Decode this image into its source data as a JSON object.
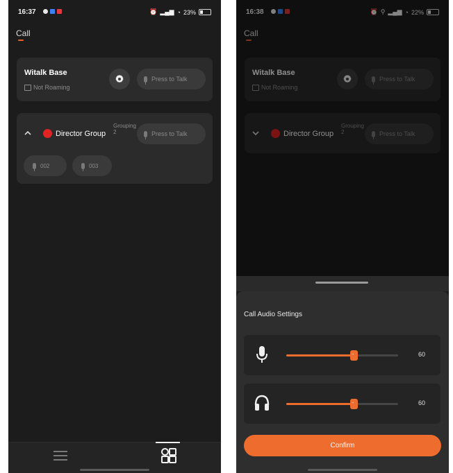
{
  "left": {
    "status": {
      "time": "16:37",
      "battery": "23%"
    },
    "app_title": "Call",
    "base": {
      "name": "Witalk Base",
      "roaming": "Not Roaming",
      "ptt_label": "Press to Talk"
    },
    "group": {
      "name": "Director Group",
      "grouping_label": "Grouping 2",
      "ptt_label": "Press to Talk",
      "members": [
        "002",
        "003"
      ]
    }
  },
  "right": {
    "status": {
      "time": "16:38",
      "battery": "22%"
    },
    "app_title": "Call",
    "base": {
      "name": "Witalk Base",
      "roaming": "Not Roaming",
      "ptt_label": "Press to Talk"
    },
    "group": {
      "name": "Director Group",
      "grouping_label": "Grouping 2",
      "ptt_label": "Press to Talk"
    },
    "sheet": {
      "title": "Call Audio Settings",
      "mic_volume": 60,
      "mic_value": "60",
      "earpiece_volume": 60,
      "earpiece_value": "60",
      "confirm_label": "Confirm"
    }
  },
  "colors": {
    "accent": "#ef6c2f",
    "group_status": "#e02424",
    "background": "#1c1c1c",
    "card": "#2b2b2b"
  }
}
